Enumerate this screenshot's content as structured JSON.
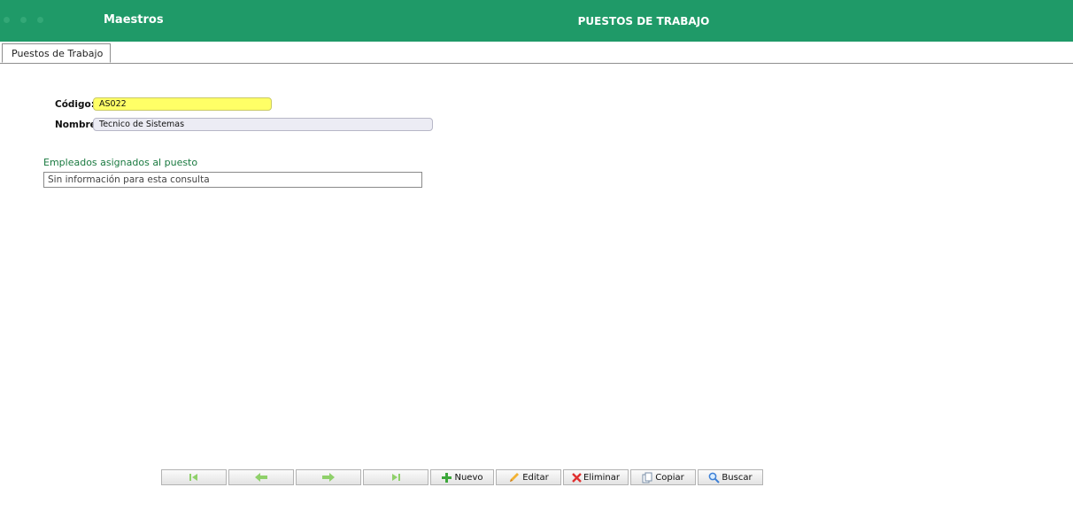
{
  "header": {
    "section": "Maestros",
    "title": "PUESTOS DE TRABAJO"
  },
  "tabs": [
    {
      "label": "Puestos de Trabajo"
    }
  ],
  "form": {
    "codigo_label": "Código:",
    "codigo_value": "AS022",
    "nombre_label": "Nombre:",
    "nombre_value": "Tecnico de Sistemas"
  },
  "empleados": {
    "label": "Empleados asignados al puesto",
    "empty_text": "Sin información para esta consulta"
  },
  "toolbar": {
    "nuevo": "Nuevo",
    "editar": "Editar",
    "eliminar": "Eliminar",
    "copiar": "Copiar",
    "buscar": "Buscar"
  },
  "colors": {
    "header_green": "#1f9a68",
    "code_highlight": "#ffff66",
    "nav_icon_green": "#8fd06a"
  }
}
